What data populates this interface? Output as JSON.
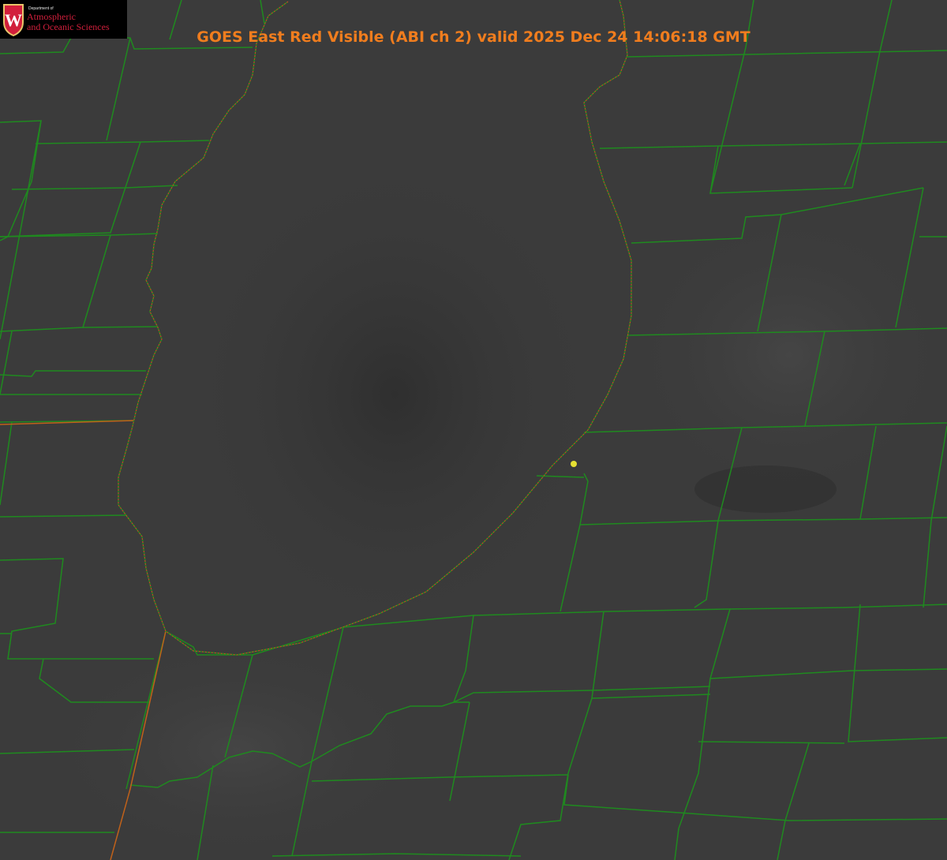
{
  "title": "GOES East Red Visible (ABI ch 2) valid 2025 Dec 24 14:06:18 GMT",
  "logo": {
    "seal_letter": "W",
    "department": "Department of",
    "line1": "Atmospheric",
    "line2": "and Oceanic Sciences"
  },
  "colors": {
    "background": "#3a3a3a",
    "county_lines": "#1f8a1f",
    "state_line": "#c0611a",
    "coastline": "#e0302a",
    "title": "#f07d1e",
    "marker": "#e6e033",
    "logo_red": "#d21f3c"
  },
  "marker": {
    "name": "station-marker"
  }
}
